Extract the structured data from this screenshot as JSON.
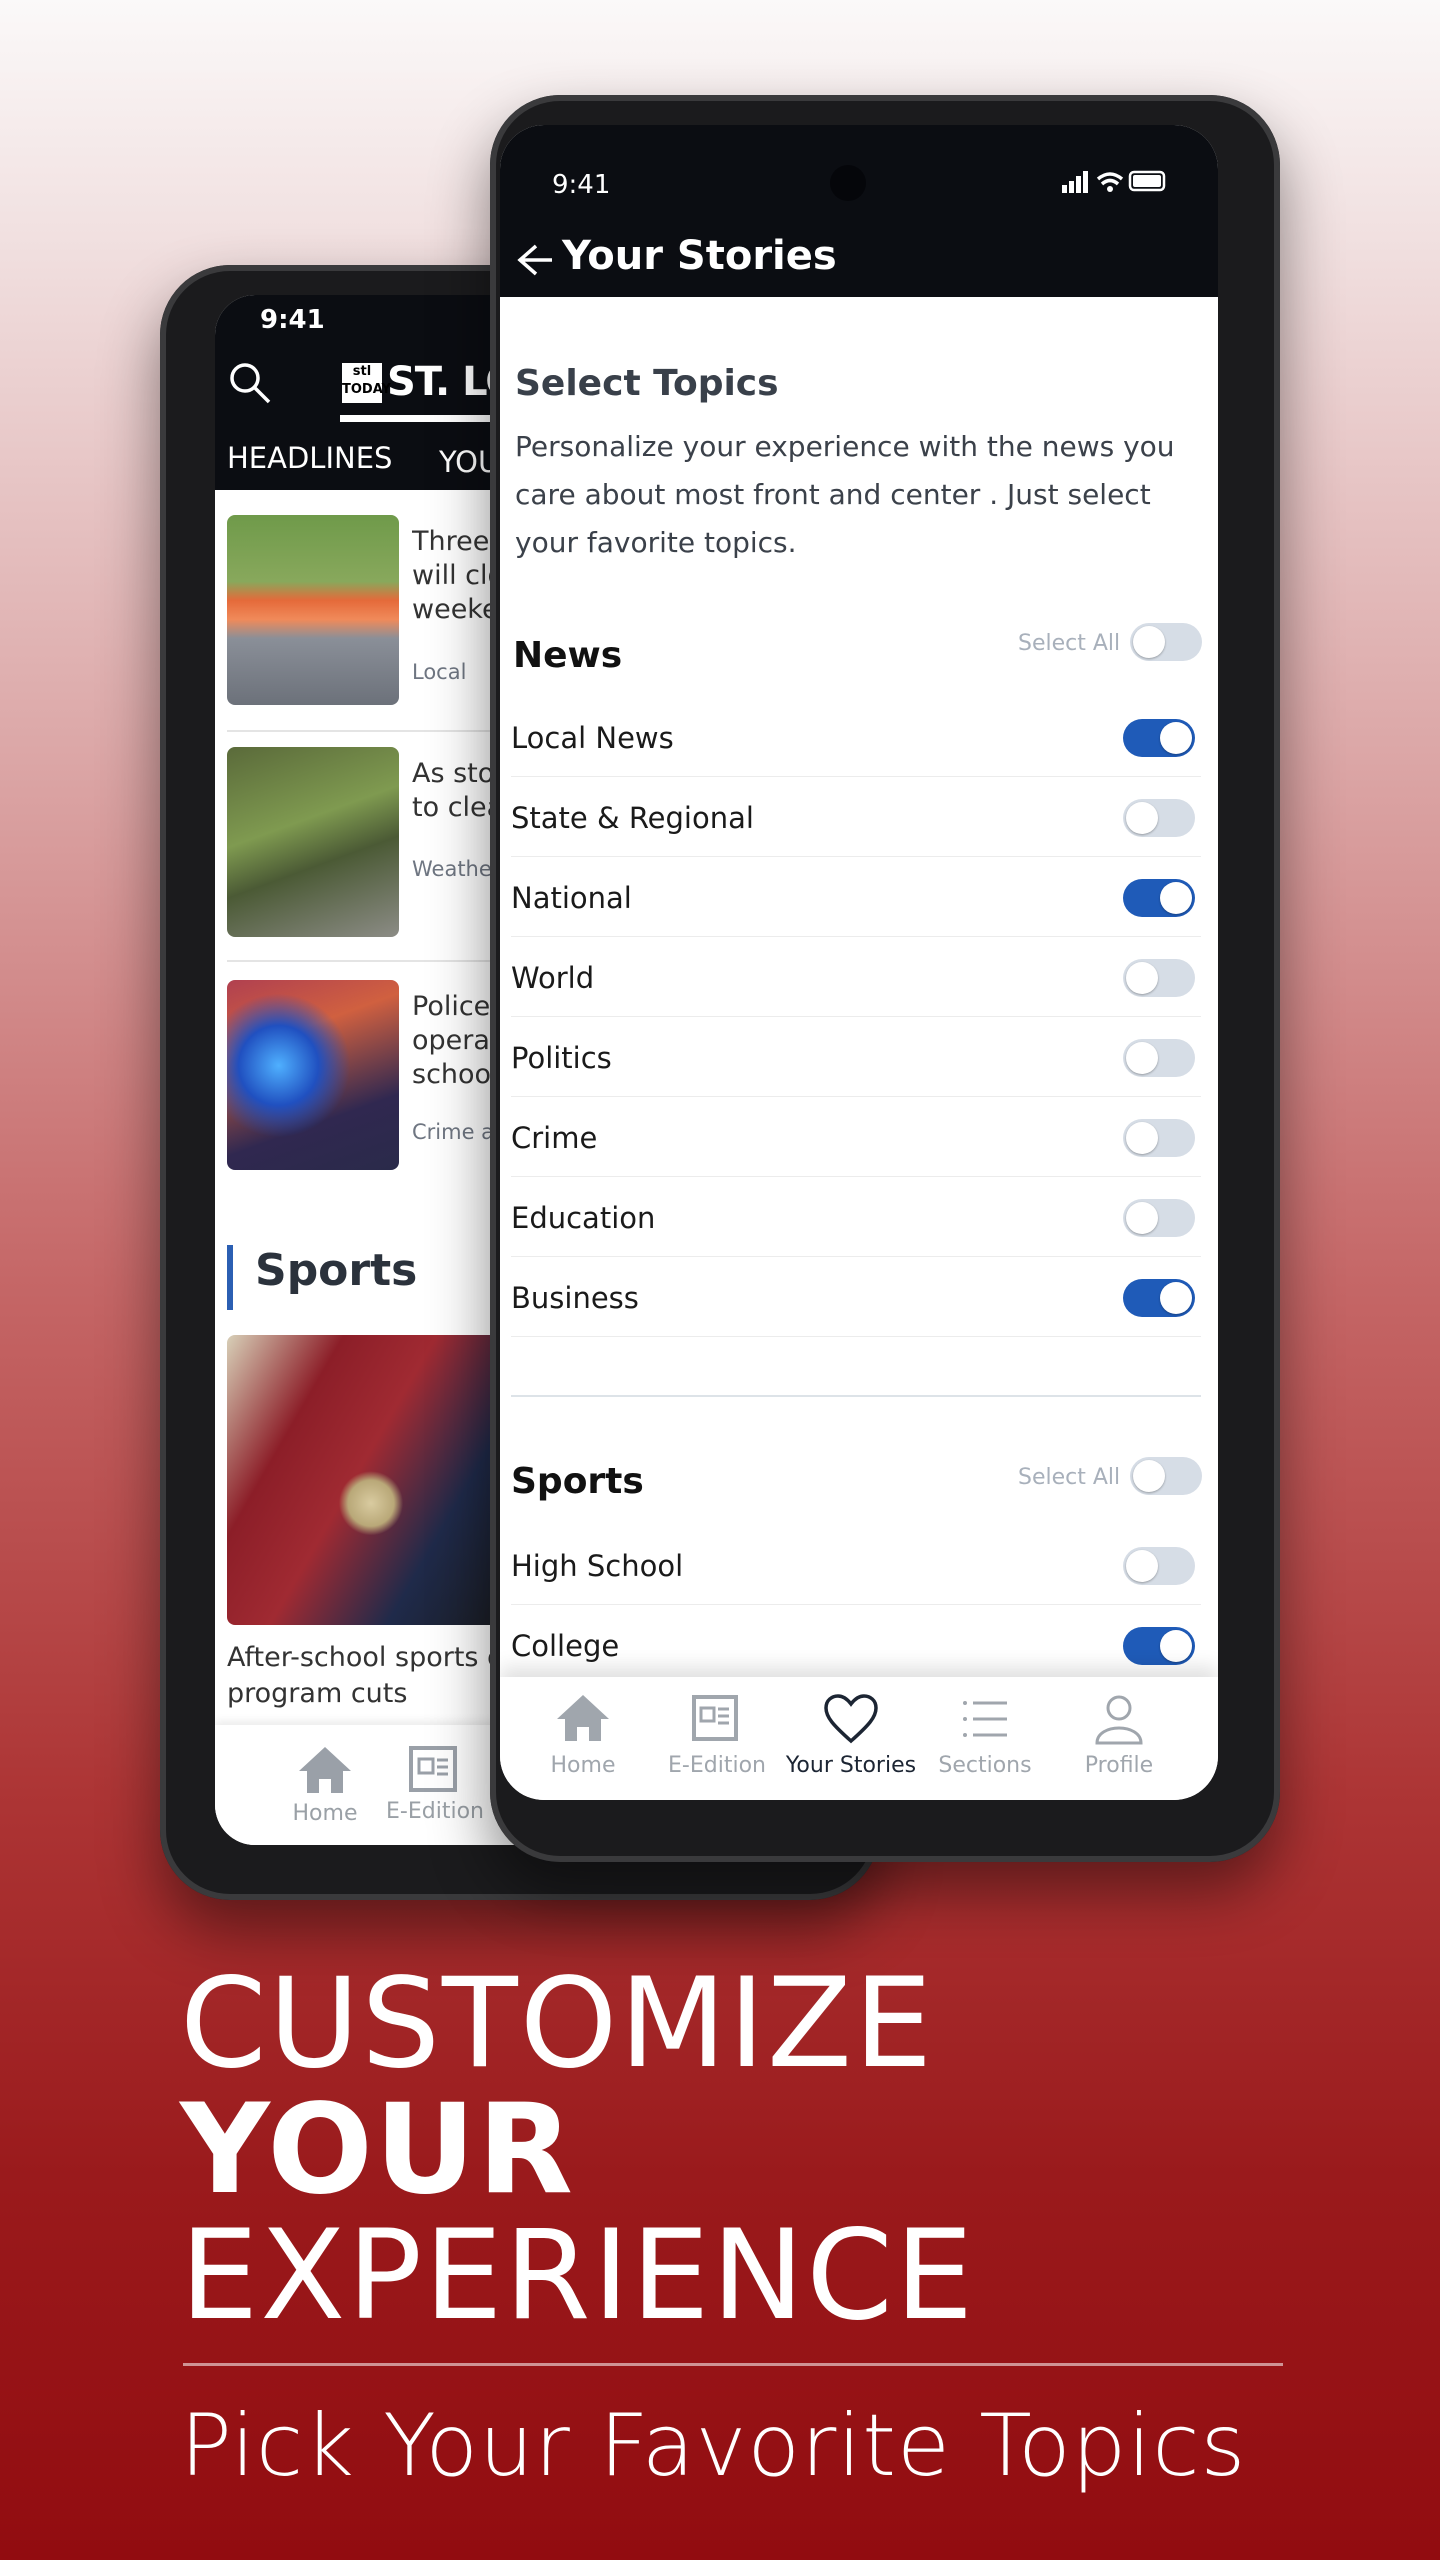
{
  "back_phone": {
    "time": "9:41",
    "logo_text": "ST. LOU",
    "logo_badge": "stl TODAY",
    "tabs": [
      "HEADLINES",
      "YOU"
    ],
    "stories": [
      {
        "title_lines": [
          "Three",
          "will clo",
          "weeke"
        ],
        "category": "Local"
      },
      {
        "title_lines": [
          "As sto",
          "to clea"
        ],
        "category": "Weather"
      },
      {
        "title_lines": [
          "Police",
          "opera",
          "schoo"
        ],
        "category": "Crime a"
      }
    ],
    "section_title": "Sports",
    "sports_headline_lines": [
      "After-school sports c",
      "program cuts"
    ],
    "nav": [
      "Home",
      "E-Edition"
    ]
  },
  "front_phone": {
    "time": "9:41",
    "header_title": "Your Stories",
    "heading": "Select Topics",
    "description": "Personalize your experience with the news you care about most front and center . Just select your favorite topics.",
    "accent": "#1f5bb8",
    "sections": [
      {
        "title": "News",
        "select_all": "Select All",
        "select_all_on": false,
        "topics": [
          {
            "label": "Local News",
            "on": true
          },
          {
            "label": "State & Regional",
            "on": false
          },
          {
            "label": "National",
            "on": true
          },
          {
            "label": "World",
            "on": false
          },
          {
            "label": "Politics",
            "on": false
          },
          {
            "label": "Crime",
            "on": false
          },
          {
            "label": "Education",
            "on": false
          },
          {
            "label": "Business",
            "on": true
          }
        ]
      },
      {
        "title": "Sports",
        "select_all": "Select All",
        "select_all_on": false,
        "topics": [
          {
            "label": "High School",
            "on": false
          },
          {
            "label": "College",
            "on": true
          }
        ]
      }
    ],
    "nav": [
      {
        "label": "Home",
        "icon": "home-icon",
        "active": false
      },
      {
        "label": "E-Edition",
        "icon": "newspaper-icon",
        "active": false
      },
      {
        "label": "Your Stories",
        "icon": "heart-icon",
        "active": true
      },
      {
        "label": "Sections",
        "icon": "list-icon",
        "active": false
      },
      {
        "label": "Profile",
        "icon": "person-icon",
        "active": false
      }
    ]
  },
  "promo": {
    "line1": "CUSTOMIZE",
    "line2": "YOUR",
    "line3": "EXPERIENCE",
    "subtitle": "Pick Your Favorite Topics"
  }
}
